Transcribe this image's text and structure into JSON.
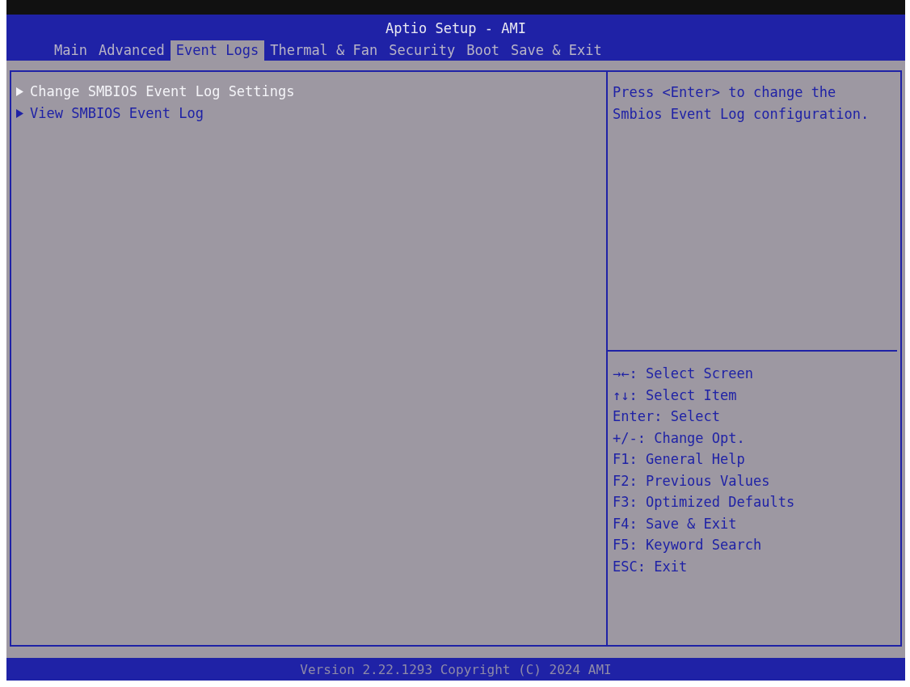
{
  "window": {
    "title": "Aptio Setup - AMI"
  },
  "tabs": [
    {
      "label": "Main",
      "selected": false
    },
    {
      "label": "Advanced",
      "selected": false
    },
    {
      "label": "Event Logs",
      "selected": true
    },
    {
      "label": "Thermal & Fan",
      "selected": false
    },
    {
      "label": "Security",
      "selected": false
    },
    {
      "label": "Boot",
      "selected": false
    },
    {
      "label": "Save & Exit",
      "selected": false
    }
  ],
  "menu": {
    "items": [
      {
        "label": "Change SMBIOS Event Log Settings",
        "selected": true
      },
      {
        "label": "View SMBIOS Event Log",
        "selected": false
      }
    ]
  },
  "help": {
    "text": "Press <Enter> to change the Smbios Event Log configuration."
  },
  "keys": [
    "→←: Select Screen",
    "↑↓: Select Item",
    "Enter: Select",
    "+/-: Change Opt.",
    "F1: General Help",
    "F2: Previous Values",
    "F3: Optimized Defaults",
    "F4: Save & Exit",
    "F5: Keyword Search",
    "ESC: Exit"
  ],
  "status_bar": "Version 2.22.1293 Copyright (C) 2024 AMI"
}
